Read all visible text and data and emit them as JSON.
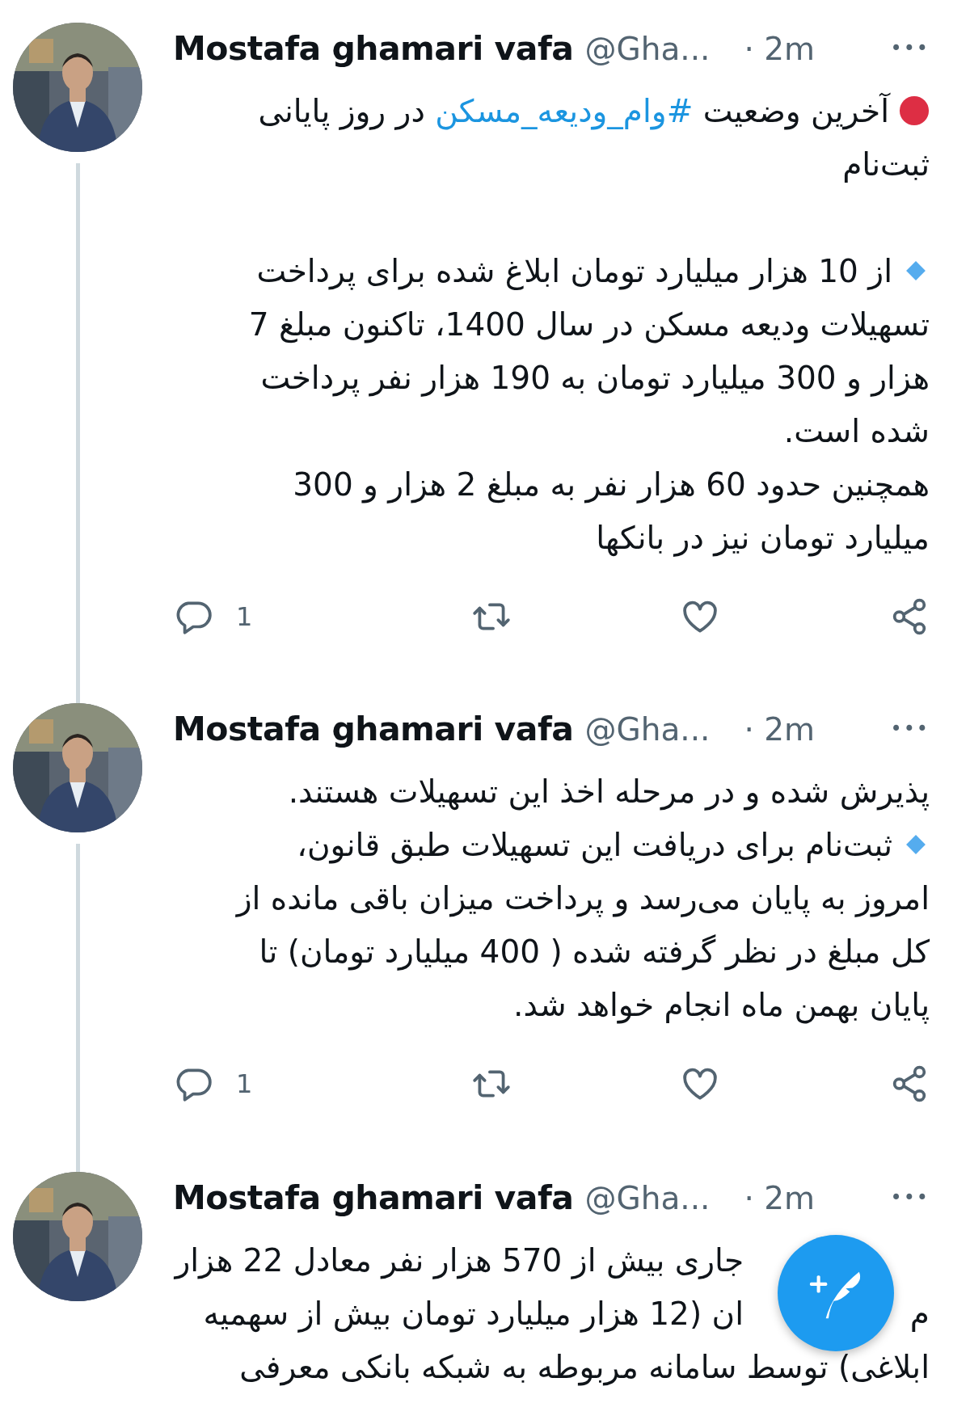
{
  "tweets": [
    {
      "author": "Mostafa ghamari vafa",
      "handle": "@Gha...",
      "time": "· 2m",
      "more": "•••",
      "connected": true,
      "paragraphs": [
        {
          "lines": [
            {
              "kind": "dot",
              "segments": [
                {
                  "kind": "text",
                  "text": "آخرین وضعیت"
                },
                {
                  "kind": "hashtag",
                  "text": "#وام_ودیعه_مسکن"
                },
                {
                  "kind": "text",
                  "text": "در روز پایانی"
                }
              ]
            },
            {
              "kind": "text",
              "text": "ثبت‌نام"
            }
          ]
        },
        {
          "lines": [
            {
              "kind": "diamond",
              "text": "از 10 هزار میلیارد تومان ابلاغ شده برای پرداخت"
            },
            {
              "kind": "text",
              "text": "تسهیلات ودیعه مسکن در سال 1400، تاکنون مبلغ 7"
            },
            {
              "kind": "text",
              "text": "هزار و 300 میلیارد تومان به 190 هزار نفر پرداخت"
            },
            {
              "kind": "text",
              "text": "شده است."
            },
            {
              "kind": "text",
              "text": "همچنین حدود 60 هزار نفر به مبلغ 2 هزار و 300"
            },
            {
              "kind": "text",
              "text": "میلیارد تومان نیز در بانکها"
            }
          ]
        }
      ],
      "actions": {
        "replies": "1"
      }
    },
    {
      "author": "Mostafa ghamari vafa",
      "handle": "@Gha...",
      "time": "· 2m",
      "more": "•••",
      "connected": true,
      "paragraphs": [
        {
          "lines": [
            {
              "kind": "text",
              "text": "پذیرش شده و در مرحله اخذ این تسهیلات هستند."
            },
            {
              "kind": "diamond",
              "text": "ثبت‌نام برای دریافت این تسهیلات طبق قانون،"
            },
            {
              "kind": "text",
              "text": "امروز به پایان می‌رسد و پرداخت میزان باقی مانده از"
            },
            {
              "kind": "text",
              "text": "کل مبلغ در نظر گرفته شده ( 400 میلیارد تومان) تا"
            },
            {
              "kind": "text",
              "text": "پایان بهمن ماه انجام خواهد شد."
            }
          ]
        }
      ],
      "actions": {
        "replies": "1"
      }
    },
    {
      "author": "Mostafa ghamari vafa",
      "handle": "@Gha...",
      "time": "· 2m",
      "more": "•••",
      "connected": false,
      "paragraphs": [
        {
          "lines": [
            {
              "kind": "covered",
              "text": "جاری بیش از 570 هزار نفر معادل 22 هزار"
            },
            {
              "kind": "covered",
              "lead": "م",
              "text": "ان (12 هزار میلیارد تومان بیش از سهمیه"
            },
            {
              "kind": "text",
              "text": "ابلاغی) توسط سامانه مربوطه به شبکه بانکی معرفی"
            }
          ]
        }
      ]
    }
  ]
}
